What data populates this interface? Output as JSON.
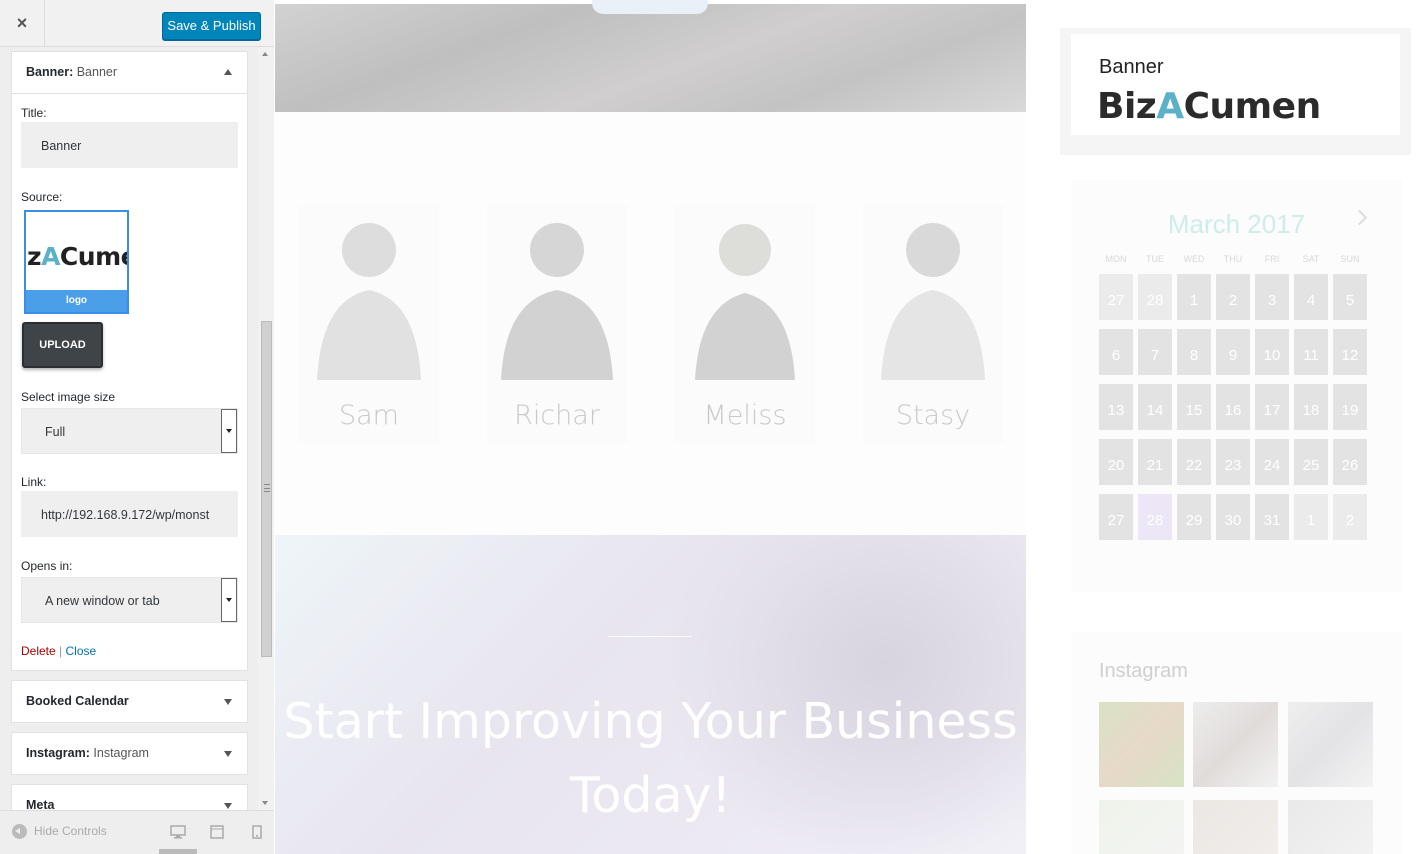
{
  "customizer": {
    "close_label": "×",
    "publish_label": "Save & Publish",
    "hide_controls_label": "Hide Controls"
  },
  "banner_widget": {
    "heading_bold": "Banner:",
    "heading_sub": "Banner",
    "title_label": "Title:",
    "title_value": "Banner",
    "source_label": "Source:",
    "thumb_text_pre": "z",
    "thumb_text_a": "A",
    "thumb_text_post": "Cume",
    "thumb_caption": "logo",
    "upload_label": "UPLOAD",
    "size_label": "Select image size",
    "size_value": "Full",
    "link_label": "Link:",
    "link_value": "http://192.168.9.172/wp/monst",
    "opens_label": "Opens in:",
    "opens_value": "A new window or tab",
    "delete_label": "Delete",
    "separator": "|",
    "close_label": "Close"
  },
  "collapsed_widgets": [
    {
      "bold": "Booked Calendar",
      "sub": ""
    },
    {
      "bold": "Instagram:",
      "sub": "Instagram"
    },
    {
      "bold": "Meta",
      "sub": ""
    }
  ],
  "preview": {
    "team": [
      "Sam",
      "Richar",
      "Meliss",
      "Stasy"
    ],
    "cta_title": "Start Improving Your Business Today!",
    "banner_title": "Banner",
    "logo_pre": "Biz",
    "logo_a": "A",
    "logo_post": "Cumen",
    "calendar": {
      "month": "March 2017",
      "weekdays": [
        "MON",
        "TUE",
        "WED",
        "THU",
        "FRI",
        "SAT",
        "SUN"
      ],
      "weeks": [
        [
          "27",
          "28",
          "1",
          "2",
          "3",
          "4",
          "5"
        ],
        [
          "6",
          "7",
          "8",
          "9",
          "10",
          "11",
          "12"
        ],
        [
          "13",
          "14",
          "15",
          "16",
          "17",
          "18",
          "19"
        ],
        [
          "20",
          "21",
          "22",
          "23",
          "24",
          "25",
          "26"
        ],
        [
          "27",
          "28",
          "29",
          "30",
          "31",
          "1",
          "2"
        ]
      ],
      "today": "28"
    },
    "instagram_title": "Instagram"
  },
  "colors": {
    "publish": "#0085ba",
    "logo_accent": "#5bb1c7",
    "delete_link": "#aa0000",
    "close_link": "#0073aa"
  }
}
